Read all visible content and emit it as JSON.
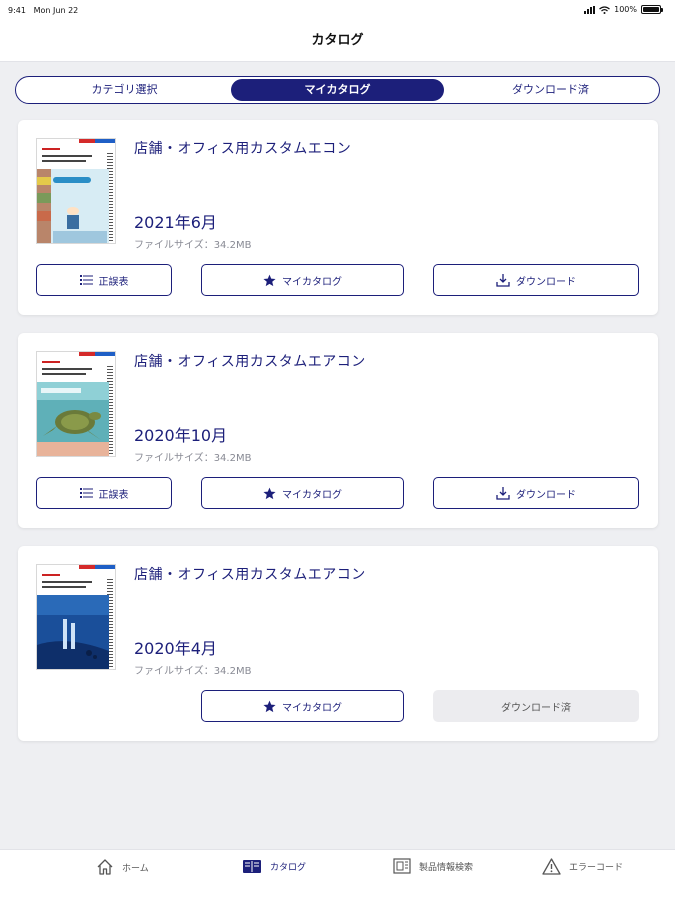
{
  "status_bar": {
    "time": "9:41",
    "date": "Mon Jun 22",
    "battery": "100%"
  },
  "header": {
    "title": "カタログ"
  },
  "segment": {
    "tabs": [
      "カテゴリ選択",
      "マイカタログ",
      "ダウンロード済"
    ],
    "active_index": 1
  },
  "catalogs": [
    {
      "title": "店舗・オフィス用カスタムエコン",
      "date": "2021年6月",
      "file_size": "ファイルサイズ：34.2MB",
      "buttons": {
        "errata": "正誤表",
        "mycatalog": "マイカタログ",
        "download": "ダウンロード"
      }
    },
    {
      "title": "店舗・オフィス用カスタムエアコン",
      "date": "2020年10月",
      "file_size": "ファイルサイズ：34.2MB",
      "buttons": {
        "errata": "正誤表",
        "mycatalog": "マイカタログ",
        "download": "ダウンロード"
      }
    },
    {
      "title": "店舗・オフィス用カスタムエアコン",
      "date": "2020年4月",
      "file_size": "ファイルサイズ：34.2MB",
      "buttons": {
        "mycatalog": "マイカタログ",
        "downloaded": "ダウンロード済"
      }
    }
  ],
  "tab_bar": {
    "items": [
      "ホーム",
      "カタログ",
      "製品情報検索",
      "エラーコード"
    ],
    "active_index": 1
  },
  "colors": {
    "accent": "#1c1f7a",
    "background": "#eeeff2"
  },
  "icons": [
    "list-icon",
    "star-icon",
    "download-icon",
    "home-icon",
    "book-icon",
    "product-search-icon",
    "warning-icon"
  ]
}
